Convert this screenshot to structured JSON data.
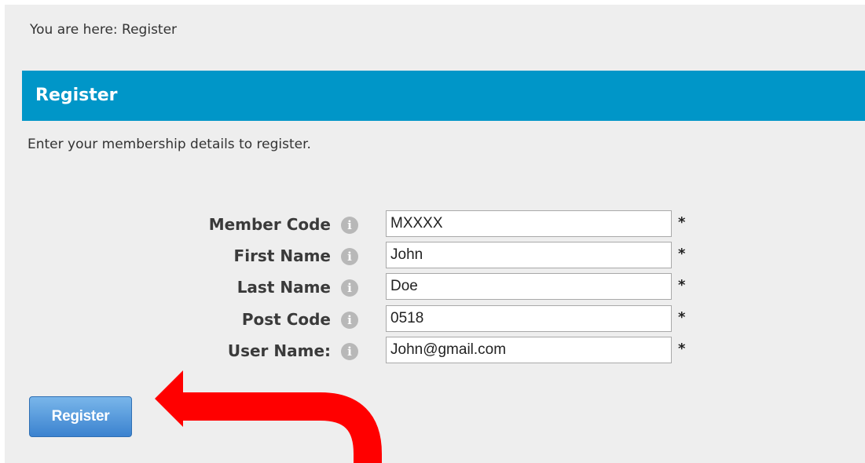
{
  "breadcrumb": {
    "text": "You are here: Register"
  },
  "header": {
    "title": "Register"
  },
  "intro": {
    "text": "Enter your membership details to register."
  },
  "form": {
    "fields": [
      {
        "label": "Member Code",
        "value": "MXXXX"
      },
      {
        "label": "First Name",
        "value": "John"
      },
      {
        "label": "Last Name",
        "value": "Doe"
      },
      {
        "label": "Post Code",
        "value": "0518"
      },
      {
        "label": "User Name:",
        "value": "John@gmail.com"
      }
    ],
    "info_icon": "i",
    "required_marker": "*",
    "submit_label": "Register"
  },
  "colors": {
    "header_bar": "#0096c8",
    "button": "#3b82cf",
    "arrow": "#ff0000"
  },
  "annotation": {
    "icon": "red-curved-arrow-icon"
  }
}
